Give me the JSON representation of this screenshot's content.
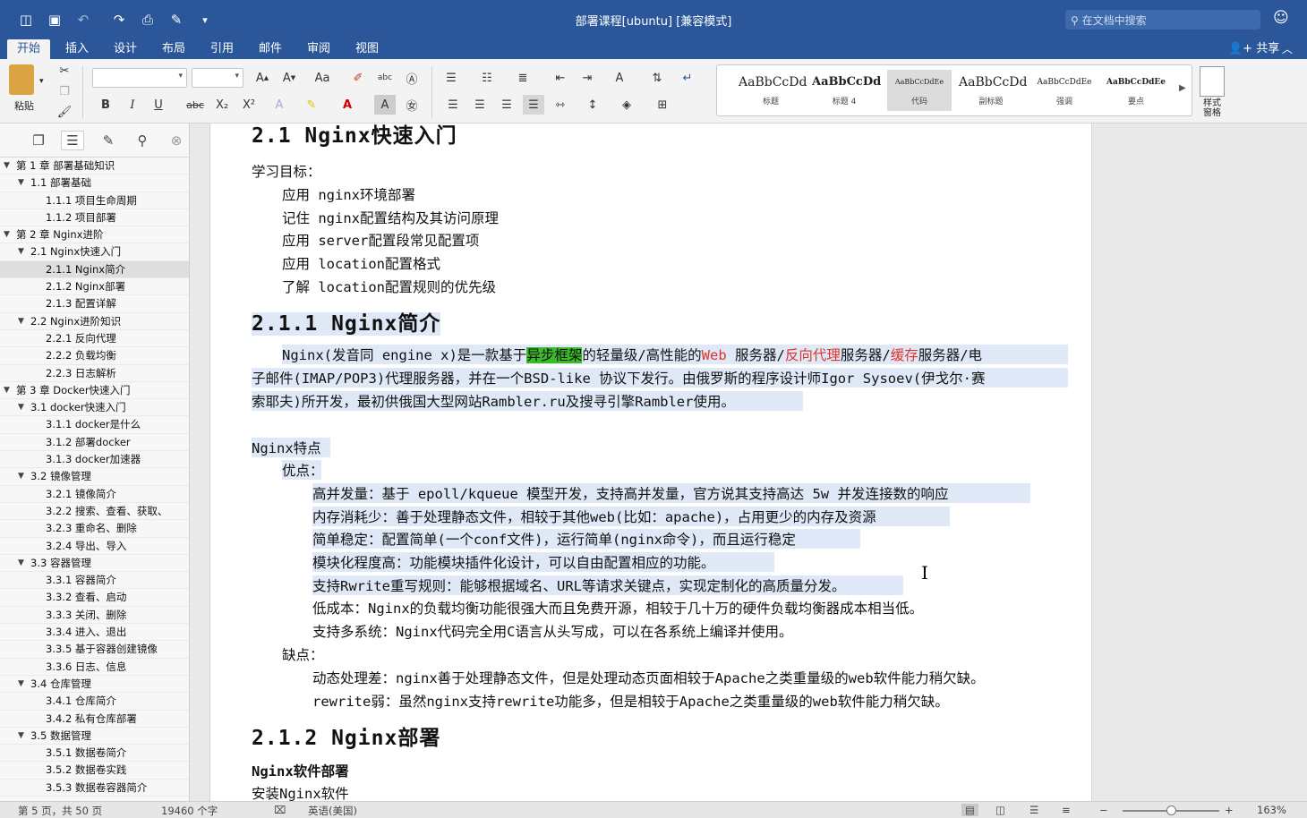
{
  "app": {
    "doc_title": "部署课程[ubuntu] [兼容模式]",
    "search_placeholder": "在文档中搜索"
  },
  "quick_access": [
    {
      "name": "sidebar-toggle-icon",
      "glyph": "◫"
    },
    {
      "name": "save-icon",
      "glyph": "💾"
    },
    {
      "name": "undo-icon",
      "glyph": "↶"
    },
    {
      "name": "redo-icon",
      "glyph": "↷"
    },
    {
      "name": "print-icon",
      "glyph": "⎙"
    },
    {
      "name": "edit-icon",
      "glyph": "✎"
    },
    {
      "name": "customize-icon",
      "glyph": "▾"
    }
  ],
  "ribbon_tabs": [
    {
      "label": "开始"
    },
    {
      "label": "插入"
    },
    {
      "label": "设计"
    },
    {
      "label": "布局"
    },
    {
      "label": "引用"
    },
    {
      "label": "邮件"
    },
    {
      "label": "审阅"
    },
    {
      "label": "视图"
    }
  ],
  "ribbon": {
    "share_label": "共享",
    "paste_label": "粘贴",
    "font_name": "",
    "font_size": "",
    "styles_pane_label": "样式\n窗格",
    "styles": [
      {
        "preview": "AaBbCcDd",
        "name": "标题"
      },
      {
        "preview": "AaBbCcDd",
        "name": "标题 4"
      },
      {
        "preview": "AaBbCcDdEe",
        "name": "代码"
      },
      {
        "preview": "AaBbCcDd",
        "name": "副标题"
      },
      {
        "preview": "AaBbCcDdEe",
        "name": "强调"
      },
      {
        "preview": "AaBbCcDdEe",
        "name": "要点"
      }
    ]
  },
  "toc": [
    {
      "label": "第 1 章 部署基础知识",
      "level": 0,
      "expanded": true
    },
    {
      "label": "1.1 部署基础",
      "level": 1,
      "expanded": true
    },
    {
      "label": "1.1.1 项目生命周期",
      "level": 2
    },
    {
      "label": "1.1.2 项目部署",
      "level": 2
    },
    {
      "label": "第 2 章 Nginx进阶",
      "level": 0,
      "expanded": true
    },
    {
      "label": "2.1 Nginx快速入门",
      "level": 1,
      "expanded": true
    },
    {
      "label": "2.1.1 Nginx简介",
      "level": 2,
      "selected": true
    },
    {
      "label": "2.1.2 Nginx部署",
      "level": 2
    },
    {
      "label": "2.1.3 配置详解",
      "level": 2
    },
    {
      "label": "2.2 Nginx进阶知识",
      "level": 1,
      "expanded": true
    },
    {
      "label": "2.2.1 反向代理",
      "level": 2
    },
    {
      "label": "2.2.2 负载均衡",
      "level": 2
    },
    {
      "label": "2.2.3 日志解析",
      "level": 2
    },
    {
      "label": "第 3 章 Docker快速入门",
      "level": 0,
      "expanded": true
    },
    {
      "label": "3.1 docker快速入门",
      "level": 1,
      "expanded": true
    },
    {
      "label": "3.1.1 docker是什么",
      "level": 2
    },
    {
      "label": "3.1.2 部署docker",
      "level": 2
    },
    {
      "label": "3.1.3 docker加速器",
      "level": 2
    },
    {
      "label": "3.2 镜像管理",
      "level": 1,
      "expanded": true
    },
    {
      "label": "3.2.1 镜像简介",
      "level": 2
    },
    {
      "label": "3.2.2 搜索、查看、获取、",
      "level": 2
    },
    {
      "label": "3.2.3 重命名、删除",
      "level": 2
    },
    {
      "label": "3.2.4 导出、导入",
      "level": 2
    },
    {
      "label": "3.3 容器管理",
      "level": 1,
      "expanded": true
    },
    {
      "label": "3.3.1 容器简介",
      "level": 2
    },
    {
      "label": "3.3.2 查看、启动",
      "level": 2
    },
    {
      "label": "3.3.3 关闭、删除",
      "level": 2
    },
    {
      "label": "3.3.4 进入、退出",
      "level": 2
    },
    {
      "label": "3.3.5 基于容器创建镜像",
      "level": 2
    },
    {
      "label": "3.3.6 日志、信息",
      "level": 2
    },
    {
      "label": "3.4 仓库管理",
      "level": 1,
      "expanded": true
    },
    {
      "label": "3.4.1 仓库简介",
      "level": 2
    },
    {
      "label": "3.4.2 私有仓库部署",
      "level": 2
    },
    {
      "label": "3.5 数据管理",
      "level": 1,
      "expanded": true
    },
    {
      "label": "3.5.1 数据卷简介",
      "level": 2
    },
    {
      "label": "3.5.2 数据卷实践",
      "level": 2
    },
    {
      "label": "3.5.3 数据卷容器简介",
      "level": 2
    }
  ],
  "doc": {
    "h_21": "2.1 Nginx快速入门",
    "goal_label": "学习目标：",
    "goals": [
      "应用 nginx环境部署",
      "记住 nginx配置结构及其访问原理",
      "应用 server配置段常见配置项",
      "应用 location配置格式",
      "了解 location配置规则的优先级"
    ],
    "h_211": "2.1.1 Nginx简介",
    "intro_p1_a": "Nginx(发音同 engine x)是一款基于",
    "intro_hl": "异步框架",
    "intro_p1_b": "的轻量级/高性能的",
    "intro_web": "Web",
    "intro_p1_c": " 服务器/",
    "intro_proxy": "反向代理",
    "intro_p1_d": "服务器/",
    "intro_cache": "缓存",
    "intro_p1_e": "服务器/电",
    "intro_p2": "子邮件(IMAP/POP3)代理服务器，并在一个BSD-like 协议下发行。由俄罗斯的程序设计师Igor Sysoev(伊戈尔·赛",
    "intro_p3": "索耶夫)所开发，最初供俄国大型网站Rambler.ru及搜寻引擎Rambler使用。",
    "features_label": "Nginx特点",
    "pros_label": "优点：",
    "pros": [
      "高并发量：基于 epoll/kqueue 模型开发，支持高并发量，官方说其支持高达 5w 并发连接数的响应",
      "内存消耗少：善于处理静态文件，相较于其他web(比如：apache)，占用更少的内存及资源",
      "简单稳定：配置简单(一个conf文件)，运行简单(nginx命令)，而且运行稳定",
      "模块化程度高：功能模块插件化设计，可以自由配置相应的功能。",
      "支持Rwrite重写规则：能够根据域名、URL等请求关键点，实现定制化的高质量分发。",
      "低成本：Nginx的负载均衡功能很强大而且免费开源，相较于几十万的硬件负载均衡器成本相当低。",
      "支持多系统：Nginx代码完全用C语言从头写成，可以在各系统上编译并使用。"
    ],
    "cons_label": "缺点：",
    "cons": [
      "动态处理差：nginx善于处理静态文件，但是处理动态页面相较于Apache之类重量级的web软件能力稍欠缺。",
      "rewrite弱：虽然nginx支持rewrite功能多，但是相较于Apache之类重量级的web软件能力稍欠缺。"
    ],
    "h_212": "2.1.2 Nginx部署",
    "deploy_label": "Nginx软件部署",
    "install_label": "安装Nginx软件"
  },
  "status": {
    "page": "第 5 页，共 50 页",
    "words": "19460 个字",
    "lang": "英语(美国)",
    "zoom": "163%"
  },
  "colors": {
    "brand": "#2b579a",
    "selection": "#dfe8f6",
    "highlight": "#3dba2a",
    "red_text": "#e0332a"
  }
}
